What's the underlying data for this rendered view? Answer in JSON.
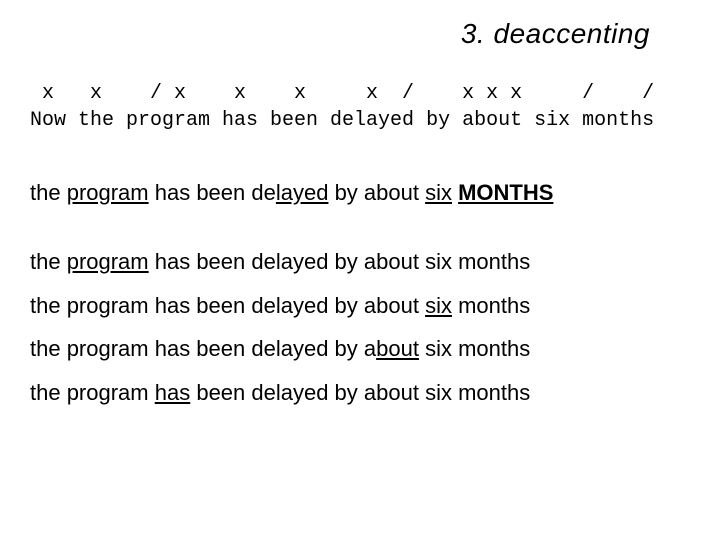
{
  "title": "3. deaccenting",
  "mono": {
    "line1": " x   x    / x    x    x     x  /    x x x     /    /",
    "line2": "Now the program has been delayed by about six months"
  },
  "examples": {
    "l1": {
      "w1": "the ",
      "w2": "program",
      "w3": " has been de",
      "w4": "layed",
      "w5": " by about ",
      "w6": "six",
      "w7": " ",
      "w8": "MONTHS"
    },
    "l2": {
      "w1": "the ",
      "w2": "program",
      "w3": " has been delayed by about six months"
    },
    "l3": {
      "w1": "the program has been delayed by about ",
      "w2": "six",
      "w3": " months"
    },
    "l4": {
      "w1": "the program has been delayed by a",
      "w2": "bout",
      "w3": " six months"
    },
    "l5": {
      "w1": "the program ",
      "w2": "has",
      "w3": " been delayed by about six months"
    }
  }
}
